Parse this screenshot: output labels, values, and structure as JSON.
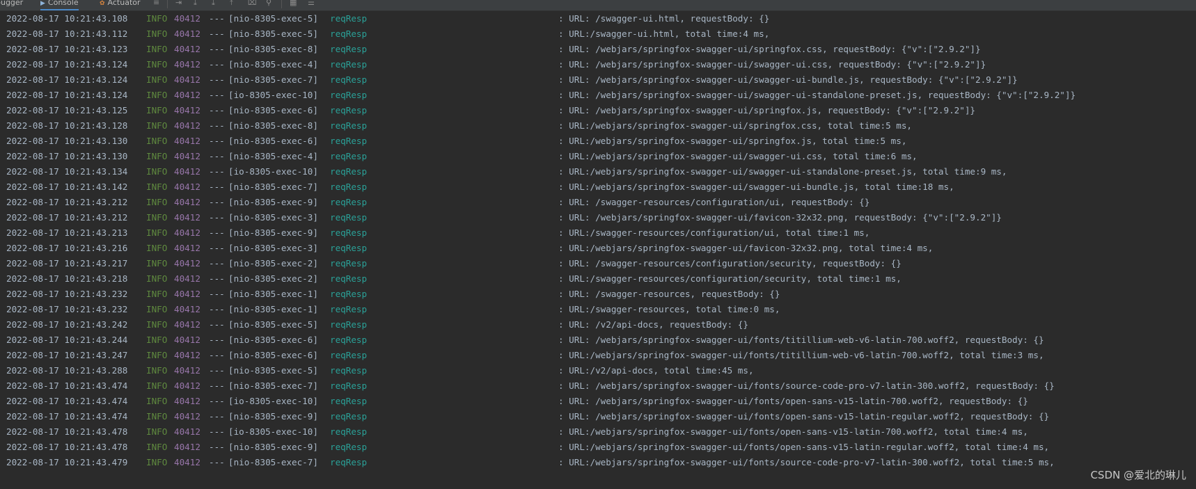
{
  "tabs": [
    {
      "label": "bugger",
      "icon": ""
    },
    {
      "label": "Console",
      "icon": "▶"
    },
    {
      "label": "Actuator",
      "icon": "✿"
    }
  ],
  "toolbar_icons": [
    "menu-icon",
    "scroll-to-end-icon",
    "download-icon",
    "download-alt-icon",
    "upload-icon",
    "clear-icon",
    "filter-icon",
    "table-icon",
    "settings-icon"
  ],
  "log_lines": [
    {
      "timestamp": "2022-08-17 10:21:43.108",
      "level": "INFO",
      "pid": "40412",
      "sep": "---",
      "thread": "[nio-8305-exec-5]",
      "logger": "reqResp",
      "message": ": URL: /swagger-ui.html, requestBody: {}"
    },
    {
      "timestamp": "2022-08-17 10:21:43.112",
      "level": "INFO",
      "pid": "40412",
      "sep": "---",
      "thread": "[nio-8305-exec-5]",
      "logger": "reqResp",
      "message": ": URL:/swagger-ui.html, total time:4 ms,"
    },
    {
      "timestamp": "2022-08-17 10:21:43.123",
      "level": "INFO",
      "pid": "40412",
      "sep": "---",
      "thread": "[nio-8305-exec-8]",
      "logger": "reqResp",
      "message": ": URL: /webjars/springfox-swagger-ui/springfox.css, requestBody: {\"v\":[\"2.9.2\"]}"
    },
    {
      "timestamp": "2022-08-17 10:21:43.124",
      "level": "INFO",
      "pid": "40412",
      "sep": "---",
      "thread": "[nio-8305-exec-4]",
      "logger": "reqResp",
      "message": ": URL: /webjars/springfox-swagger-ui/swagger-ui.css, requestBody: {\"v\":[\"2.9.2\"]}"
    },
    {
      "timestamp": "2022-08-17 10:21:43.124",
      "level": "INFO",
      "pid": "40412",
      "sep": "---",
      "thread": "[nio-8305-exec-7]",
      "logger": "reqResp",
      "message": ": URL: /webjars/springfox-swagger-ui/swagger-ui-bundle.js, requestBody: {\"v\":[\"2.9.2\"]}"
    },
    {
      "timestamp": "2022-08-17 10:21:43.124",
      "level": "INFO",
      "pid": "40412",
      "sep": "---",
      "thread": "[io-8305-exec-10]",
      "logger": "reqResp",
      "message": ": URL: /webjars/springfox-swagger-ui/swagger-ui-standalone-preset.js, requestBody: {\"v\":[\"2.9.2\"]}"
    },
    {
      "timestamp": "2022-08-17 10:21:43.125",
      "level": "INFO",
      "pid": "40412",
      "sep": "---",
      "thread": "[nio-8305-exec-6]",
      "logger": "reqResp",
      "message": ": URL: /webjars/springfox-swagger-ui/springfox.js, requestBody: {\"v\":[\"2.9.2\"]}"
    },
    {
      "timestamp": "2022-08-17 10:21:43.128",
      "level": "INFO",
      "pid": "40412",
      "sep": "---",
      "thread": "[nio-8305-exec-8]",
      "logger": "reqResp",
      "message": ": URL:/webjars/springfox-swagger-ui/springfox.css, total time:5 ms,"
    },
    {
      "timestamp": "2022-08-17 10:21:43.130",
      "level": "INFO",
      "pid": "40412",
      "sep": "---",
      "thread": "[nio-8305-exec-6]",
      "logger": "reqResp",
      "message": ": URL:/webjars/springfox-swagger-ui/springfox.js, total time:5 ms,"
    },
    {
      "timestamp": "2022-08-17 10:21:43.130",
      "level": "INFO",
      "pid": "40412",
      "sep": "---",
      "thread": "[nio-8305-exec-4]",
      "logger": "reqResp",
      "message": ": URL:/webjars/springfox-swagger-ui/swagger-ui.css, total time:6 ms,"
    },
    {
      "timestamp": "2022-08-17 10:21:43.134",
      "level": "INFO",
      "pid": "40412",
      "sep": "---",
      "thread": "[io-8305-exec-10]",
      "logger": "reqResp",
      "message": ": URL:/webjars/springfox-swagger-ui/swagger-ui-standalone-preset.js, total time:9 ms,"
    },
    {
      "timestamp": "2022-08-17 10:21:43.142",
      "level": "INFO",
      "pid": "40412",
      "sep": "---",
      "thread": "[nio-8305-exec-7]",
      "logger": "reqResp",
      "message": ": URL:/webjars/springfox-swagger-ui/swagger-ui-bundle.js, total time:18 ms,"
    },
    {
      "timestamp": "2022-08-17 10:21:43.212",
      "level": "INFO",
      "pid": "40412",
      "sep": "---",
      "thread": "[nio-8305-exec-9]",
      "logger": "reqResp",
      "message": ": URL: /swagger-resources/configuration/ui, requestBody: {}"
    },
    {
      "timestamp": "2022-08-17 10:21:43.212",
      "level": "INFO",
      "pid": "40412",
      "sep": "---",
      "thread": "[nio-8305-exec-3]",
      "logger": "reqResp",
      "message": ": URL: /webjars/springfox-swagger-ui/favicon-32x32.png, requestBody: {\"v\":[\"2.9.2\"]}"
    },
    {
      "timestamp": "2022-08-17 10:21:43.213",
      "level": "INFO",
      "pid": "40412",
      "sep": "---",
      "thread": "[nio-8305-exec-9]",
      "logger": "reqResp",
      "message": ": URL:/swagger-resources/configuration/ui, total time:1 ms,"
    },
    {
      "timestamp": "2022-08-17 10:21:43.216",
      "level": "INFO",
      "pid": "40412",
      "sep": "---",
      "thread": "[nio-8305-exec-3]",
      "logger": "reqResp",
      "message": ": URL:/webjars/springfox-swagger-ui/favicon-32x32.png, total time:4 ms,"
    },
    {
      "timestamp": "2022-08-17 10:21:43.217",
      "level": "INFO",
      "pid": "40412",
      "sep": "---",
      "thread": "[nio-8305-exec-2]",
      "logger": "reqResp",
      "message": ": URL: /swagger-resources/configuration/security, requestBody: {}"
    },
    {
      "timestamp": "2022-08-17 10:21:43.218",
      "level": "INFO",
      "pid": "40412",
      "sep": "---",
      "thread": "[nio-8305-exec-2]",
      "logger": "reqResp",
      "message": ": URL:/swagger-resources/configuration/security, total time:1 ms,"
    },
    {
      "timestamp": "2022-08-17 10:21:43.232",
      "level": "INFO",
      "pid": "40412",
      "sep": "---",
      "thread": "[nio-8305-exec-1]",
      "logger": "reqResp",
      "message": ": URL: /swagger-resources, requestBody: {}"
    },
    {
      "timestamp": "2022-08-17 10:21:43.232",
      "level": "INFO",
      "pid": "40412",
      "sep": "---",
      "thread": "[nio-8305-exec-1]",
      "logger": "reqResp",
      "message": ": URL:/swagger-resources, total time:0 ms,"
    },
    {
      "timestamp": "2022-08-17 10:21:43.242",
      "level": "INFO",
      "pid": "40412",
      "sep": "---",
      "thread": "[nio-8305-exec-5]",
      "logger": "reqResp",
      "message": ": URL: /v2/api-docs, requestBody: {}"
    },
    {
      "timestamp": "2022-08-17 10:21:43.244",
      "level": "INFO",
      "pid": "40412",
      "sep": "---",
      "thread": "[nio-8305-exec-6]",
      "logger": "reqResp",
      "message": ": URL: /webjars/springfox-swagger-ui/fonts/titillium-web-v6-latin-700.woff2, requestBody: {}"
    },
    {
      "timestamp": "2022-08-17 10:21:43.247",
      "level": "INFO",
      "pid": "40412",
      "sep": "---",
      "thread": "[nio-8305-exec-6]",
      "logger": "reqResp",
      "message": ": URL:/webjars/springfox-swagger-ui/fonts/titillium-web-v6-latin-700.woff2, total time:3 ms,"
    },
    {
      "timestamp": "2022-08-17 10:21:43.288",
      "level": "INFO",
      "pid": "40412",
      "sep": "---",
      "thread": "[nio-8305-exec-5]",
      "logger": "reqResp",
      "message": ": URL:/v2/api-docs, total time:45 ms,"
    },
    {
      "timestamp": "2022-08-17 10:21:43.474",
      "level": "INFO",
      "pid": "40412",
      "sep": "---",
      "thread": "[nio-8305-exec-7]",
      "logger": "reqResp",
      "message": ": URL: /webjars/springfox-swagger-ui/fonts/source-code-pro-v7-latin-300.woff2, requestBody: {}"
    },
    {
      "timestamp": "2022-08-17 10:21:43.474",
      "level": "INFO",
      "pid": "40412",
      "sep": "---",
      "thread": "[io-8305-exec-10]",
      "logger": "reqResp",
      "message": ": URL: /webjars/springfox-swagger-ui/fonts/open-sans-v15-latin-700.woff2, requestBody: {}"
    },
    {
      "timestamp": "2022-08-17 10:21:43.474",
      "level": "INFO",
      "pid": "40412",
      "sep": "---",
      "thread": "[nio-8305-exec-9]",
      "logger": "reqResp",
      "message": ": URL: /webjars/springfox-swagger-ui/fonts/open-sans-v15-latin-regular.woff2, requestBody: {}"
    },
    {
      "timestamp": "2022-08-17 10:21:43.478",
      "level": "INFO",
      "pid": "40412",
      "sep": "---",
      "thread": "[io-8305-exec-10]",
      "logger": "reqResp",
      "message": ": URL:/webjars/springfox-swagger-ui/fonts/open-sans-v15-latin-700.woff2, total time:4 ms,"
    },
    {
      "timestamp": "2022-08-17 10:21:43.478",
      "level": "INFO",
      "pid": "40412",
      "sep": "---",
      "thread": "[nio-8305-exec-9]",
      "logger": "reqResp",
      "message": ": URL:/webjars/springfox-swagger-ui/fonts/open-sans-v15-latin-regular.woff2, total time:4 ms,"
    },
    {
      "timestamp": "2022-08-17 10:21:43.479",
      "level": "INFO",
      "pid": "40412",
      "sep": "---",
      "thread": "[nio-8305-exec-7]",
      "logger": "reqResp",
      "message": ": URL:/webjars/springfox-swagger-ui/fonts/source-code-pro-v7-latin-300.woff2, total time:5 ms,"
    }
  ],
  "watermark": "CSDN @爱北的琳儿",
  "colors": {
    "background": "#2b2b2b",
    "text": "#a9b7c6",
    "level_info": "#5f8a3f",
    "pid": "#9876aa",
    "logger": "#2aa198",
    "active_tab_underline": "#4a88c7"
  }
}
